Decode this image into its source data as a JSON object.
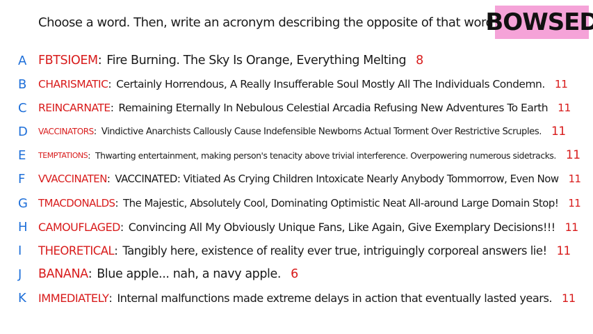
{
  "prompt": "Choose a word. Then, write an acronym describing the opposite of that word!",
  "logo": {
    "text": "BOWSED",
    "bg_color": "#f5a3d8"
  },
  "colors": {
    "letter": "#1e6fd9",
    "word": "#d81b1b",
    "count": "#d81b1b",
    "text": "#1a1a1a"
  },
  "answers": [
    {
      "letter": "A",
      "word": "FBTSIOEM",
      "phrase": "Fire Burning. The Sky Is Orange, Everything Melting",
      "count": "8"
    },
    {
      "letter": "B",
      "word": "CHARISMATIC",
      "phrase": "Certainly Horrendous, A Really Insufferable Soul Mostly All The Individuals Condemn.",
      "count": "11"
    },
    {
      "letter": "C",
      "word": "REINCARNATE",
      "phrase": "Remaining Eternally In Nebulous Celestial Arcadia Refusing New Adventures To Earth",
      "count": "11"
    },
    {
      "letter": "D",
      "word": "VACCINATORS",
      "phrase": "Vindictive Anarchists Callously Cause Indefensible Newborns Actual Torment Over Restrictive Scruples.",
      "count": "11"
    },
    {
      "letter": "E",
      "word": "TEMPTATIONS",
      "phrase": "Thwarting entertainment, making person's tenacity above trivial interference. Overpowering numerous sidetracks.",
      "count": "11"
    },
    {
      "letter": "F",
      "word": "VVACCINATEN",
      "phrase": "VACCINATED: Vitiated As Crying Children Intoxicate Nearly Anybody Tommorrow, Even Now",
      "count": "11"
    },
    {
      "letter": "G",
      "word": "TMACDONALDS",
      "phrase": "The Majestic, Absolutely Cool, Dominating Optimistic Neat All-around Large Domain Stop!",
      "count": "11"
    },
    {
      "letter": "H",
      "word": "CAMOUFLAGED",
      "phrase": "Convincing All My Obviously Unique Fans, Like Again, Give Exemplary Decisions!!!",
      "count": "11"
    },
    {
      "letter": "I",
      "word": "THEORETICAL",
      "phrase": "Tangibly here, existence of reality ever true, intriguingly corporeal answers lie!",
      "count": "11"
    },
    {
      "letter": "J",
      "word": "BANANA",
      "phrase": "Blue apple... nah, a navy apple.",
      "count": "6"
    },
    {
      "letter": "K",
      "word": "IMMEDIATELY",
      "phrase": "Internal malfunctions made extreme delays in action that eventually lasted years.",
      "count": "11"
    }
  ]
}
